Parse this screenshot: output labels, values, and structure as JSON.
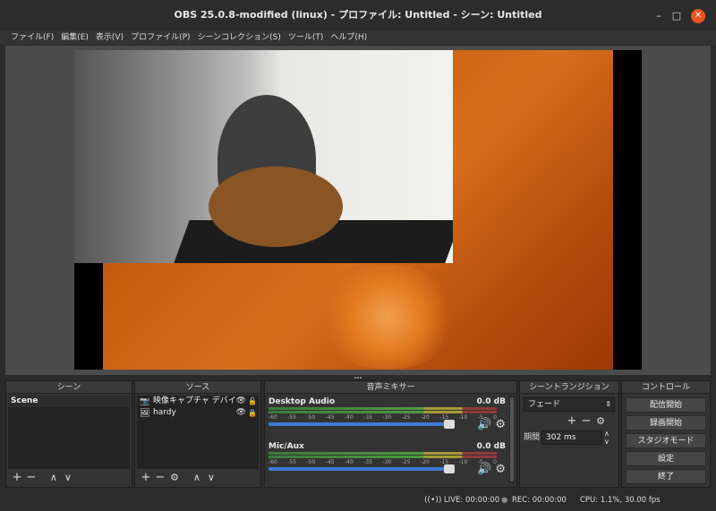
{
  "window": {
    "title": "OBS 25.0.8-modified (linux) - プロファイル: Untitled - シーン: Untitled"
  },
  "menu": [
    "ファイル(F)",
    "編集(E)",
    "表示(V)",
    "プロファイル(P)",
    "シーンコレクション(S)",
    "ツール(T)",
    "ヘルプ(H)"
  ],
  "docks": {
    "scenes": {
      "title": "シーン",
      "items": [
        "Scene"
      ]
    },
    "sources": {
      "title": "ソース",
      "items": [
        {
          "label": "映像キャプチャ デバイ",
          "icon": "camera-icon"
        },
        {
          "label": "hardy",
          "icon": "image-icon"
        }
      ]
    },
    "mixer": {
      "title": "音声ミキサー",
      "ticks": [
        "-60",
        "-55",
        "-50",
        "-45",
        "-40",
        "-35",
        "-30",
        "-25",
        "-20",
        "-15",
        "-10",
        "-5",
        "0"
      ],
      "channels": [
        {
          "name": "Desktop Audio",
          "db": "0.0 dB",
          "volume": 0.97
        },
        {
          "name": "Mic/Aux",
          "db": "0.0 dB",
          "volume": 0.97
        }
      ]
    },
    "transitions": {
      "title": "シーントランジション",
      "selected": "フェード",
      "duration_label": "期間",
      "duration": "302 ms"
    },
    "controls": {
      "title": "コントロール",
      "buttons": [
        "配信開始",
        "録画開始",
        "スタジオモード",
        "設定",
        "終了"
      ]
    }
  },
  "status": {
    "live": "LIVE: 00:00:00",
    "rec": "REC: 00:00:00",
    "cpu": "CPU: 1.1%, 30.00 fps"
  }
}
